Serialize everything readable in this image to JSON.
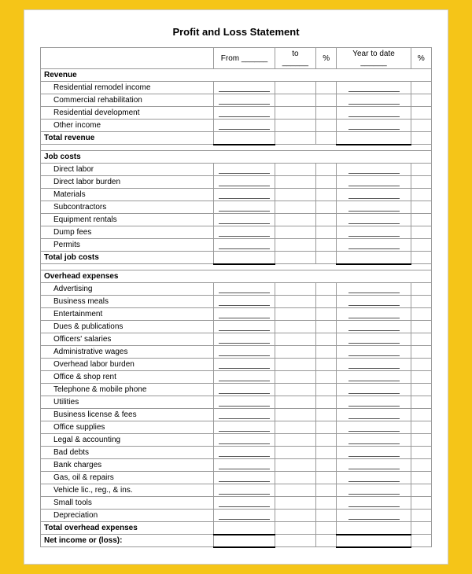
{
  "title": "Profit and Loss Statement",
  "headers": {
    "from": "From ______",
    "to": "to ______",
    "pct": "%",
    "ytd": "Year to date ______",
    "pct2": "%"
  },
  "sections": [
    {
      "type": "section-header",
      "label": "Revenue"
    },
    {
      "type": "row",
      "label": "Residential remodel income",
      "indented": true
    },
    {
      "type": "row",
      "label": "Commercial rehabilitation",
      "indented": true
    },
    {
      "type": "row",
      "label": "Residential development",
      "indented": true
    },
    {
      "type": "row",
      "label": "Other income",
      "indented": true
    },
    {
      "type": "total",
      "label": "Total revenue"
    },
    {
      "type": "blank"
    },
    {
      "type": "section-header",
      "label": "Job costs"
    },
    {
      "type": "row",
      "label": "Direct labor",
      "indented": true
    },
    {
      "type": "row",
      "label": "Direct labor burden",
      "indented": true
    },
    {
      "type": "row",
      "label": "Materials",
      "indented": true
    },
    {
      "type": "row",
      "label": "Subcontractors",
      "indented": true
    },
    {
      "type": "row",
      "label": "Equipment rentals",
      "indented": true
    },
    {
      "type": "row",
      "label": "Dump fees",
      "indented": true
    },
    {
      "type": "row",
      "label": "Permits",
      "indented": true
    },
    {
      "type": "total",
      "label": "Total job costs"
    },
    {
      "type": "blank"
    },
    {
      "type": "section-header",
      "label": "Overhead expenses"
    },
    {
      "type": "row",
      "label": "Advertising",
      "indented": true
    },
    {
      "type": "row",
      "label": "Business meals",
      "indented": true
    },
    {
      "type": "row",
      "label": "Entertainment",
      "indented": true
    },
    {
      "type": "row",
      "label": "Dues & publications",
      "indented": true
    },
    {
      "type": "row",
      "label": "Officers' salaries",
      "indented": true
    },
    {
      "type": "row",
      "label": "Administrative wages",
      "indented": true
    },
    {
      "type": "row",
      "label": "Overhead labor burden",
      "indented": true
    },
    {
      "type": "row",
      "label": "Office & shop rent",
      "indented": true
    },
    {
      "type": "row",
      "label": "Telephone & mobile phone",
      "indented": true
    },
    {
      "type": "row",
      "label": "Utilities",
      "indented": true
    },
    {
      "type": "row",
      "label": "Business license & fees",
      "indented": true
    },
    {
      "type": "row",
      "label": "Office supplies",
      "indented": true
    },
    {
      "type": "row",
      "label": "Legal & accounting",
      "indented": true
    },
    {
      "type": "row",
      "label": "Bad debts",
      "indented": true
    },
    {
      "type": "row",
      "label": "Bank charges",
      "indented": true
    },
    {
      "type": "row",
      "label": "Gas, oil & repairs",
      "indented": true
    },
    {
      "type": "row",
      "label": "Vehicle lic., reg., & ins.",
      "indented": true
    },
    {
      "type": "row",
      "label": "Small tools",
      "indented": true
    },
    {
      "type": "row",
      "label": "Depreciation",
      "indented": true
    },
    {
      "type": "total",
      "label": "Total overhead expenses"
    },
    {
      "type": "total",
      "label": "Net income or (loss):"
    }
  ]
}
